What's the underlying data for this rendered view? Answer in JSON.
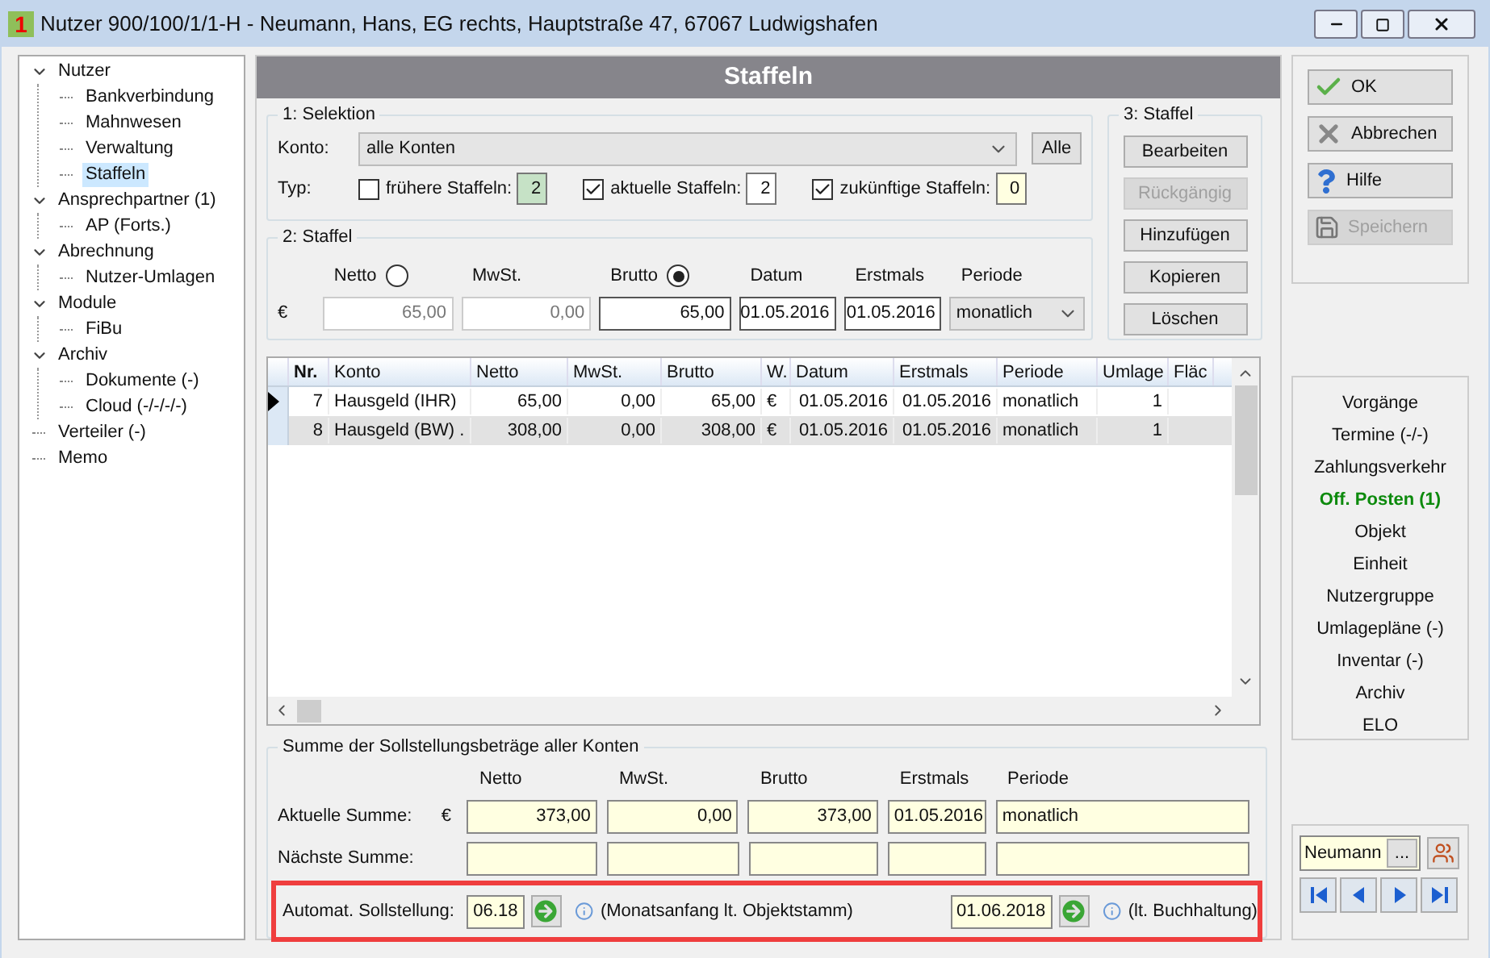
{
  "window": {
    "title": "Nutzer 900/100/1/1-H - Neumann, Hans, EG rechts, Hauptstraße 47, 67067 Ludwigshafen",
    "icon_text": "1"
  },
  "tree": [
    {
      "label": "Nutzer",
      "expanded": true,
      "selected": false,
      "children": [
        {
          "label": "Bankverbindung",
          "selected": false
        },
        {
          "label": "Mahnwesen",
          "selected": false
        },
        {
          "label": "Verwaltung",
          "selected": false
        },
        {
          "label": "Staffeln",
          "selected": true
        }
      ]
    },
    {
      "label": "Ansprechpartner (1)",
      "expanded": true,
      "selected": false,
      "children": [
        {
          "label": "AP (Forts.)",
          "selected": false
        }
      ]
    },
    {
      "label": "Abrechnung",
      "expanded": true,
      "selected": false,
      "children": [
        {
          "label": "Nutzer-Umlagen",
          "selected": false
        }
      ]
    },
    {
      "label": "Module",
      "expanded": true,
      "selected": false,
      "children": [
        {
          "label": "FiBu",
          "selected": false
        }
      ]
    },
    {
      "label": "Archiv",
      "expanded": true,
      "selected": false,
      "children": [
        {
          "label": "Dokumente (-)",
          "selected": false
        },
        {
          "label": "Cloud (-/-/-/-)",
          "selected": false
        }
      ]
    },
    {
      "label": "Verteiler (-)",
      "selected": false
    },
    {
      "label": "Memo",
      "selected": false
    }
  ],
  "panel_title": "Staffeln",
  "selektion": {
    "title": "1: Selektion",
    "konto_label": "Konto:",
    "konto_value": "alle Konten",
    "all_button": "Alle",
    "typ_label": "Typ:",
    "types": [
      {
        "label": "frühere Staffeln:",
        "checked": false,
        "count": "2",
        "color": "#c6e2c6"
      },
      {
        "label": "aktuelle Staffeln:",
        "checked": true,
        "count": "2",
        "color": "#ffffff"
      },
      {
        "label": "zukünftige Staffeln:",
        "checked": true,
        "count": "0",
        "color": "#ffffe1"
      }
    ]
  },
  "staffel": {
    "title": "2: Staffel",
    "currency": "€",
    "columns": [
      {
        "label": "Netto",
        "kind": "radio",
        "selected": false,
        "value": "65,00",
        "disabled": true
      },
      {
        "label": "MwSt.",
        "kind": "plain",
        "value": "0,00",
        "disabled": true
      },
      {
        "label": "Brutto",
        "kind": "radio",
        "selected": true,
        "value": "65,00",
        "disabled": false
      },
      {
        "label": "Datum",
        "kind": "plain",
        "value": "01.05.2016",
        "disabled": false
      },
      {
        "label": "Erstmals",
        "kind": "plain",
        "value": "01.05.2016",
        "disabled": false
      },
      {
        "label": "Periode",
        "kind": "select",
        "value": "monatlich",
        "disabled": false
      }
    ]
  },
  "actions": {
    "title": "3: Staffel",
    "buttons": [
      {
        "label": "Bearbeiten",
        "disabled": false
      },
      {
        "label": "Rückgängig",
        "disabled": true
      },
      {
        "label": "Hinzufügen",
        "disabled": false
      },
      {
        "label": "Kopieren",
        "disabled": false
      },
      {
        "label": "Löschen",
        "disabled": false
      }
    ]
  },
  "table": {
    "columns": [
      "Nr.",
      "Konto",
      "Netto",
      "MwSt.",
      "Brutto",
      "W.",
      "Datum",
      "Erstmals",
      "Periode",
      "Umlage",
      "Fläc"
    ],
    "rows": [
      {
        "current": true,
        "selected": false,
        "cells": [
          "7",
          "Hausgeld (IHR)",
          "65,00",
          "0,00",
          "65,00",
          "€",
          "01.05.2016",
          "01.05.2016",
          "monatlich",
          "1"
        ]
      },
      {
        "current": false,
        "selected": true,
        "cells": [
          "8",
          "Hausgeld (BW) .",
          "308,00",
          "0,00",
          "308,00",
          "€",
          "01.05.2016",
          "01.05.2016",
          "monatlich",
          "1"
        ]
      }
    ]
  },
  "summe": {
    "title": "Summe der Sollstellungsbeträge aller Konten",
    "headers": [
      "Netto",
      "MwSt.",
      "Brutto",
      "Erstmals",
      "Periode"
    ],
    "rows": [
      {
        "label": "Aktuelle Summe:",
        "currency": "€",
        "values": [
          "373,00",
          "0,00",
          "373,00",
          "01.05.2016",
          "monatlich"
        ]
      },
      {
        "label": "Nächste Summe:"
      }
    ]
  },
  "automat": {
    "label": "Automat. Sollstellung:",
    "month": "06.18",
    "month_note": "(Monatsanfang lt. Objektstamm)",
    "date": "01.06.2018",
    "date_note": "(lt. Buchhaltung)"
  },
  "dialog_buttons": [
    {
      "label": "OK",
      "kind": "ok",
      "disabled": false
    },
    {
      "label": "Abbrechen",
      "kind": "cancel",
      "disabled": false
    },
    {
      "label": "Hilfe",
      "kind": "help",
      "disabled": false
    },
    {
      "label": "Speichern",
      "kind": "save",
      "disabled": true
    }
  ],
  "links": [
    {
      "label": "Vorgänge",
      "highlighted": false
    },
    {
      "label": "Termine (-/-)",
      "highlighted": false
    },
    {
      "label": "Zahlungsverkehr",
      "highlighted": false
    },
    {
      "label": "Off. Posten (1)",
      "highlighted": true
    },
    {
      "label": "Objekt",
      "highlighted": false
    },
    {
      "label": "Einheit",
      "highlighted": false
    },
    {
      "label": "Nutzergruppe",
      "highlighted": false
    },
    {
      "label": "Umlagepläne (-)",
      "highlighted": false
    },
    {
      "label": "Inventar (-)",
      "highlighted": false
    },
    {
      "label": "Archiv",
      "highlighted": false
    },
    {
      "label": "ELO",
      "highlighted": false
    }
  ],
  "navigator": {
    "name": "Neumann",
    "browse": "..."
  }
}
